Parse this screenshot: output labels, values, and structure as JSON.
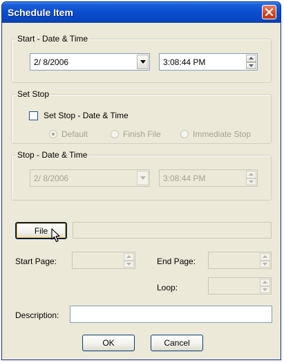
{
  "window": {
    "title": "Schedule Item",
    "close_icon": "close-icon"
  },
  "start_group": {
    "legend": "Start - Date & Time",
    "date_value": "2/  8/2006",
    "time_value": "3:08:44 PM"
  },
  "set_stop_group": {
    "legend": "Set Stop",
    "checkbox_label": "Set Stop - Date & Time",
    "checkbox_checked": false,
    "radios": [
      {
        "label": "Default",
        "selected": true
      },
      {
        "label": "Finish File",
        "selected": false
      },
      {
        "label": "Immediate Stop",
        "selected": false
      }
    ]
  },
  "stop_group": {
    "legend": "Stop - Date & Time",
    "date_value": "2/  8/2006",
    "time_value": "3:08:44 PM"
  },
  "file": {
    "button_label": "File",
    "path_value": ""
  },
  "pages": {
    "start_label": "Start Page:",
    "start_value": "",
    "end_label": "End Page:",
    "end_value": "",
    "loop_label": "Loop:",
    "loop_value": ""
  },
  "description": {
    "label": "Description:",
    "value": ""
  },
  "buttons": {
    "ok_label": "OK",
    "cancel_label": "Cancel"
  },
  "colors": {
    "titlebar": "#0a4ccf",
    "dialog_bg": "#ece9d8",
    "close_button": "#d2461f"
  }
}
